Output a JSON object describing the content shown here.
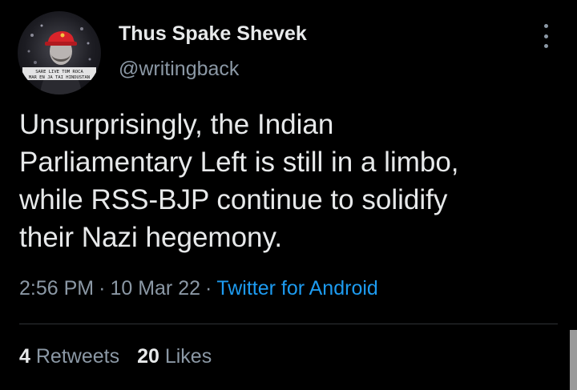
{
  "author": {
    "display_name": "Thus Spake Shevek",
    "handle": "@writingback",
    "avatar_caption": "Sare Live Tom Roca Mar En Ja Tai Hindustan"
  },
  "tweet": {
    "text": "Unsurprisingly, the Indian\nParliamentary Left is still in a limbo,\nwhile RSS-BJP continue to solidify\ntheir Nazi hegemony.",
    "time": "2:56 PM",
    "date": "10 Mar 22",
    "separator": "·",
    "source": "Twitter for Android"
  },
  "stats": {
    "retweets_count": "4",
    "retweets_label": "Retweets",
    "likes_count": "20",
    "likes_label": "Likes"
  },
  "icons": {
    "more": "more-vertical-icon"
  },
  "colors": {
    "background": "#000000",
    "primary_text": "#e7e9ea",
    "secondary_text": "#8b98a5",
    "link": "#1d9bf0",
    "divider": "#2f3336"
  }
}
